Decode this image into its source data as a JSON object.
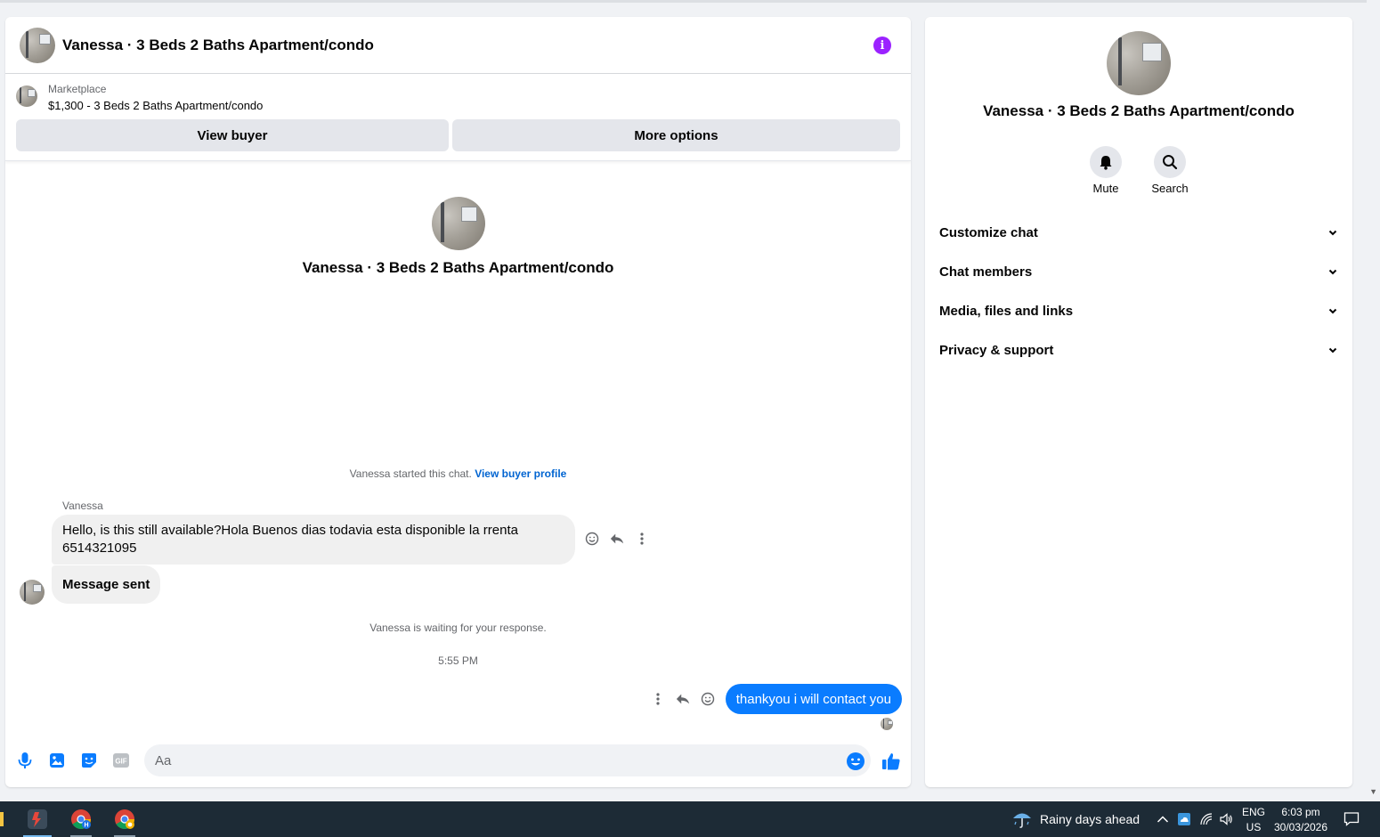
{
  "chat": {
    "title": "Vanessa · 3 Beds 2 Baths Apartment/condo",
    "listing_source": "Marketplace",
    "listing_info": "$1,300 - 3 Beds 2 Baths Apartment/condo",
    "view_buyer_label": "View buyer",
    "more_options_label": "More options",
    "profile_name": "Vanessa · 3 Beds 2 Baths Apartment/condo",
    "started_text": "Vanessa started this chat.",
    "view_profile_link": "View buyer profile",
    "sender_name": "Vanessa",
    "incoming_message": "Hello, is this still available?Hola Buenos dias  todavia esta disponible la rrenta 6514321095",
    "sent_status": "Message sent",
    "waiting_text": "Vanessa is waiting for your response.",
    "timestamp": "5:55 PM",
    "outgoing_message": "thankyou i will contact you",
    "input_placeholder": "Aa",
    "accent_color": "#0a7cff"
  },
  "info_panel": {
    "name": "Vanessa · 3 Beds 2 Baths Apartment/condo",
    "mute_label": "Mute",
    "search_label": "Search",
    "sections": [
      "Customize chat",
      "Chat members",
      "Media, files and links",
      "Privacy & support"
    ]
  },
  "taskbar": {
    "weather_text": "Rainy days ahead",
    "lang_top": "ENG",
    "lang_bottom": "US",
    "time": "6:03 pm",
    "date": "30/03/2026"
  }
}
